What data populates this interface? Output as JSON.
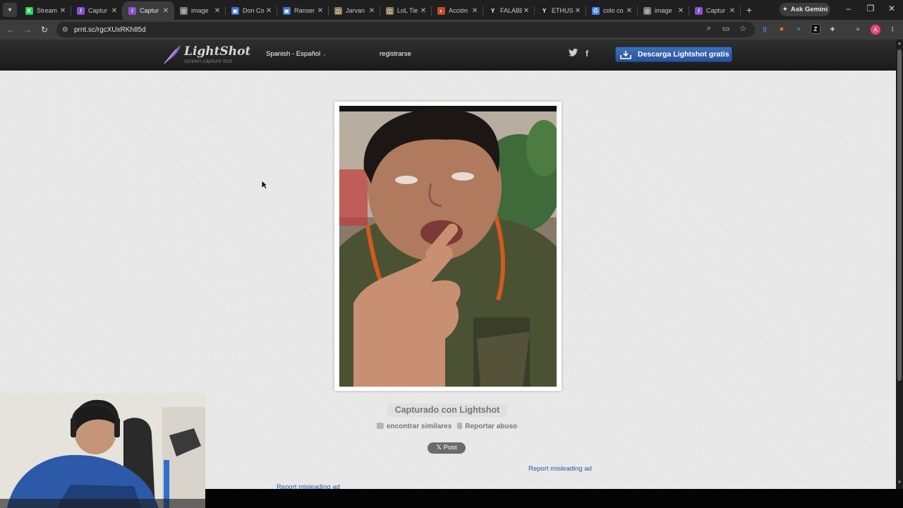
{
  "browser": {
    "tabs": [
      {
        "title": "Stream",
        "fav": "K",
        "fav_color": "#1fd14f",
        "active": false
      },
      {
        "title": "Captur",
        "fav": "/",
        "fav_color": "#8a4fd6",
        "active": false
      },
      {
        "title": "Captur",
        "fav": "/",
        "fav_color": "#8a4fd6",
        "active": true
      },
      {
        "title": "image",
        "fav": "◎",
        "fav_color": "#7a7a7a",
        "active": false
      },
      {
        "title": "Don Co",
        "fav": "▣",
        "fav_color": "#3b6fd8",
        "active": false
      },
      {
        "title": "Ranser",
        "fav": "▣",
        "fav_color": "#3b6fd8",
        "active": false
      },
      {
        "title": "Jarvan",
        "fav": "◫",
        "fav_color": "#8d7a55",
        "active": false
      },
      {
        "title": "LoL Tie",
        "fav": "◫",
        "fav_color": "#8d7a55",
        "active": false
      },
      {
        "title": "Acción",
        "fav": "◐",
        "fav_color": "#c94a2b",
        "active": false
      },
      {
        "title": "FALABE",
        "fav": "Y",
        "fav_color": "#1f1f1f",
        "active": false
      },
      {
        "title": "ETHUSI",
        "fav": "Y",
        "fav_color": "#1f1f1f",
        "active": false
      },
      {
        "title": "colo co",
        "fav": "G",
        "fav_color": "#4285f4",
        "active": false
      },
      {
        "title": "image",
        "fav": "◎",
        "fav_color": "#7a7a7a",
        "active": false
      },
      {
        "title": "Captur",
        "fav": "/",
        "fav_color": "#8a4fd6",
        "active": false
      }
    ],
    "new_tab": "+",
    "gemini_label": "Ask Gemini",
    "url": "prnt.sc/rgcXUxRKh85d",
    "profile_initial": "A"
  },
  "site": {
    "logo_name": "LightShot",
    "logo_tagline": "screen capture tool",
    "language": "Spanish - Español",
    "register": "registrarse",
    "twitter_icon": "twitter-icon",
    "facebook_icon": "facebook-icon",
    "download_label": "Descarga Lightshot gratis",
    "captured_label": "Capturado con Lightshot",
    "similar_label": "encontrar similares",
    "report_label": "Reportar abuso",
    "post_label": "𝕏 Post",
    "report_ad_1": "Report misleading ad",
    "report_ad_2": "Report misleading ad"
  },
  "colors": {
    "page_bg": "#e6e6e6",
    "header_bg": "#242424",
    "button_blue": "#2f5fa6",
    "link_blue": "#2a5a9c"
  }
}
